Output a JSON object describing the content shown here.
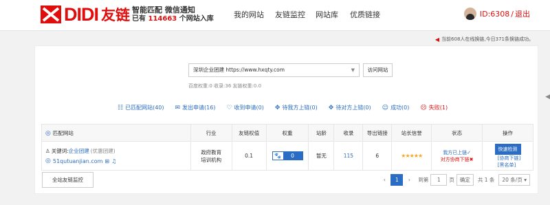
{
  "brand": {
    "logo_text": "DIDI",
    "logo_cn": "友链",
    "slogan_line1": "智能匹配 微信通知",
    "slogan_prefix": "已有",
    "slogan_count": "114663",
    "slogan_suffix": "个网站入库",
    "accent": "#e10d0d"
  },
  "nav": {
    "items": [
      "我的网站",
      "友链监控",
      "网站库",
      "优质链接"
    ]
  },
  "user": {
    "id_label": "ID:6308",
    "separator": "/",
    "logout": "退出"
  },
  "notice": {
    "text": "当前608人在线换链,今日371条换链成功。"
  },
  "site": {
    "selected": "深圳企业团建 https://www.hxqty.com",
    "visit_label": "访问网站",
    "meta": "百度权重:0 收录:36 友链权重:0.0"
  },
  "filters": [
    {
      "icon": "matched-icon",
      "label": "已匹配网站(40)"
    },
    {
      "icon": "send-icon",
      "label": "发出申请(16)"
    },
    {
      "icon": "receive-icon",
      "label": "收到申请(0)"
    },
    {
      "icon": "link-up-icon",
      "label": "待我方上链(0)"
    },
    {
      "icon": "link-wait-icon",
      "label": "待对方上链(0)"
    },
    {
      "icon": "success-icon",
      "label": "成功(0)"
    },
    {
      "icon": "fail-icon",
      "label": "失败(1)"
    }
  ],
  "table": {
    "headers": [
      "匹配网站",
      "行业",
      "友链权值",
      "权重",
      "站龄",
      "收录",
      "导出链接",
      "站长信誉",
      "状态",
      "操作"
    ],
    "rows": [
      {
        "keyword_label": "关键词:",
        "keyword": "企业团建",
        "keyword_note": "(优惠团建)",
        "domain": "51qutuanjian.com",
        "industry_line1": "政府教育",
        "industry_line2": "培训机构",
        "link_weight": "0.1",
        "weight": "0",
        "age": "暂无",
        "indexed": "115",
        "outlinks": "6",
        "stars": 5,
        "status1": "我方已上链✓",
        "status2": "对方协商下链✖",
        "check_label": "快速检测",
        "link1": "[协商下链]",
        "link2": "[黑名单]"
      }
    ]
  },
  "footer": {
    "monitor_label": "全站友链监控",
    "current_page": "1",
    "goto_label": "到第",
    "page_input": "1",
    "page_unit": "页",
    "confirm": "确定",
    "total": "共 1 条",
    "page_size": "20 条/页"
  }
}
